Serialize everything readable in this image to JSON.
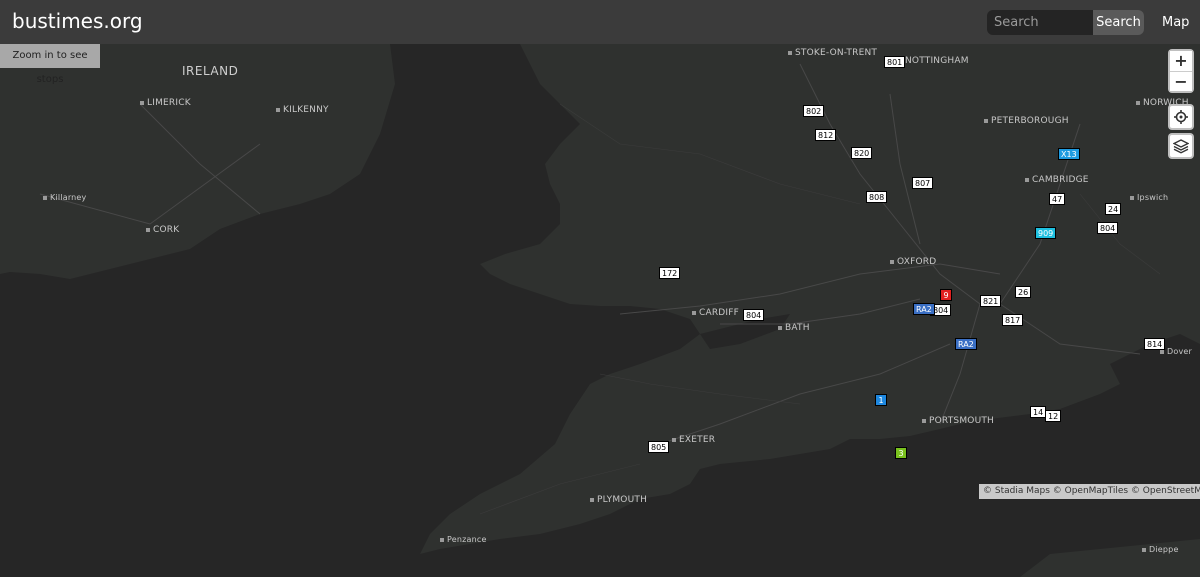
{
  "header": {
    "brand": "bustimes.org",
    "search_placeholder": "Search",
    "search_button": "Search",
    "map_link": "Map"
  },
  "map": {
    "zoom_hint": "Zoom in to see stops",
    "zoom_in": "+",
    "zoom_out": "−",
    "attribution": "© Stadia Maps © OpenMapTiles © OpenStreetMap",
    "countries": [
      "IRELAND"
    ],
    "places": [
      "STOKE-ON-TRENT",
      "NOTTINGHAM",
      "NORWICH",
      "LIMERICK",
      "KILKENNY",
      "PETERBOROUGH",
      "CAMBRIDGE",
      "Ipswich",
      "Killarney",
      "CORK",
      "OXFORD",
      "CARDIFF",
      "BATH",
      "Dover",
      "EXETER",
      "PORTSMOUTH",
      "PLYMOUTH",
      "Penzance",
      "Dieppe"
    ],
    "vehicles": [
      {
        "label": "802",
        "color": "#ffffff",
        "text": "#000000"
      },
      {
        "label": "812",
        "color": "#ffffff",
        "text": "#000000"
      },
      {
        "label": "820",
        "color": "#ffffff",
        "text": "#000000"
      },
      {
        "label": "807",
        "color": "#ffffff",
        "text": "#000000"
      },
      {
        "label": "808",
        "color": "#ffffff",
        "text": "#000000"
      },
      {
        "label": "801",
        "color": "#ffffff",
        "text": "#000000"
      },
      {
        "label": "47",
        "color": "#ffffff",
        "text": "#000000"
      },
      {
        "label": "24",
        "color": "#ffffff",
        "text": "#000000"
      },
      {
        "label": "804",
        "color": "#ffffff",
        "text": "#000000"
      },
      {
        "label": "X13",
        "color": "#1e9be0",
        "text": "#ffffff"
      },
      {
        "label": "909",
        "color": "#1ec0e0",
        "text": "#ffffff"
      },
      {
        "label": "172",
        "color": "#ffffff",
        "text": "#000000"
      },
      {
        "label": "804",
        "color": "#ffffff",
        "text": "#000000"
      },
      {
        "label": "804",
        "color": "#ffffff",
        "text": "#000000"
      },
      {
        "label": "RA2",
        "color": "#3a6fc4",
        "text": "#ffffff"
      },
      {
        "label": "RA2",
        "color": "#3a6fc4",
        "text": "#ffffff"
      },
      {
        "label": "821",
        "color": "#ffffff",
        "text": "#000000"
      },
      {
        "label": "9",
        "color": "#e02020",
        "text": "#ffffff"
      },
      {
        "label": "14",
        "color": "#ffffff",
        "text": "#000000"
      },
      {
        "label": "817",
        "color": "#ffffff",
        "text": "#000000"
      },
      {
        "label": "12",
        "color": "#ffffff",
        "text": "#000000"
      },
      {
        "label": "805",
        "color": "#ffffff",
        "text": "#000000"
      },
      {
        "label": "3",
        "color": "#7ac21e",
        "text": "#ffffff"
      },
      {
        "label": "814",
        "color": "#ffffff",
        "text": "#000000"
      },
      {
        "label": "1",
        "color": "#1e88e0",
        "text": "#ffffff"
      },
      {
        "label": "26",
        "color": "#ffffff",
        "text": "#000000"
      }
    ],
    "colors": {
      "land": "#2f312f",
      "sea": "#262626",
      "road": "#4a4a4a",
      "header": "#3b3b3b"
    }
  }
}
